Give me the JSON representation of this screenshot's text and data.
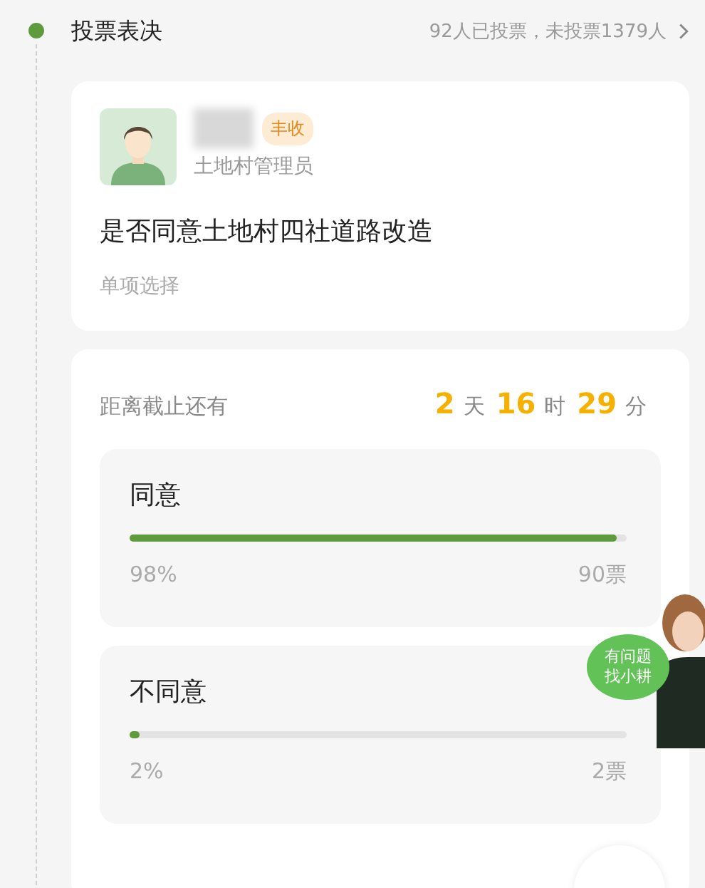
{
  "section": {
    "title": "投票表决",
    "summary": "92人已投票，未投票1379人"
  },
  "post": {
    "tag": "丰收",
    "role": "土地村管理员",
    "question": "是否同意土地村四社道路改造",
    "mode": "单项选择"
  },
  "deadline": {
    "label": "距离截止还有",
    "parts": [
      {
        "kind": "number",
        "text": "2"
      },
      {
        "kind": "unit",
        "text": "天"
      },
      {
        "kind": "number",
        "text": "16"
      },
      {
        "kind": "unit",
        "text": "时"
      },
      {
        "kind": "number",
        "text": "29"
      },
      {
        "kind": "unit",
        "text": "分"
      }
    ]
  },
  "options": [
    {
      "label": "同意",
      "level": 0.98,
      "percent": "98%",
      "votes": "90票"
    },
    {
      "label": "不同意",
      "level": 0.02,
      "percent": "2%",
      "votes": "2票"
    }
  ],
  "helper": {
    "bubble": [
      "有问题",
      "找小耕"
    ]
  }
}
